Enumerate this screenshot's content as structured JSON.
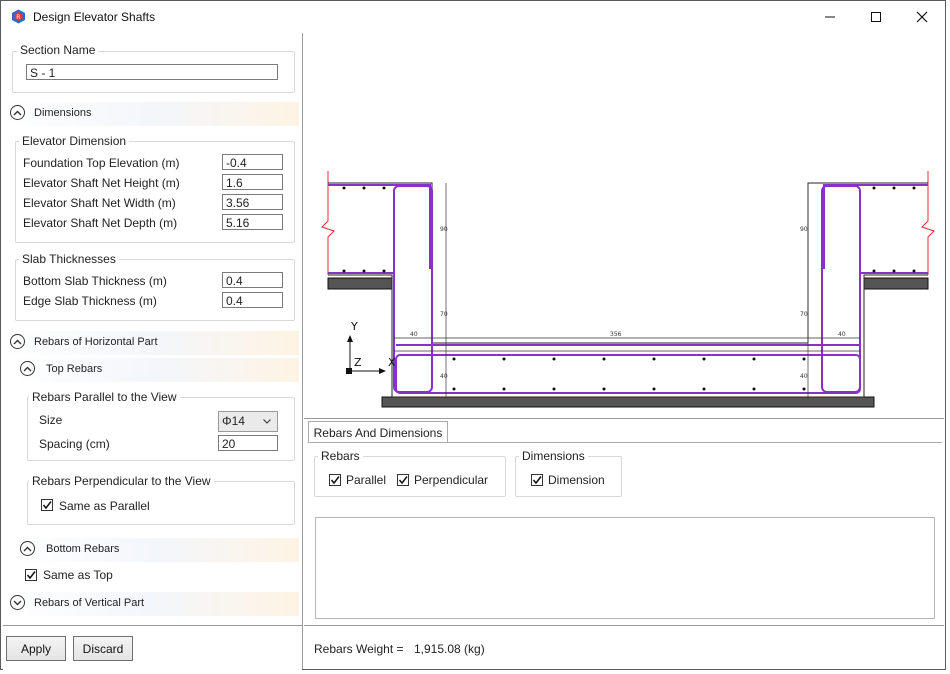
{
  "window": {
    "title": "Design Elevator Shafts",
    "controls": {
      "minimize": "minimize",
      "maximize": "maximize",
      "close": "close"
    }
  },
  "section": {
    "group_title": "Section Name",
    "value": "S - 1"
  },
  "dimensions": {
    "header": "Dimensions",
    "elevator_group": "Elevator Dimension",
    "fields": [
      {
        "label": "Foundation Top Elevation (m)",
        "value": "-0.4"
      },
      {
        "label": "Elevator Shaft Net Height (m)",
        "value": "1.6"
      },
      {
        "label": "Elevator Shaft Net Width (m)",
        "value": "3.56"
      },
      {
        "label": "Elevator Shaft Net Depth (m)",
        "value": "5.16"
      }
    ],
    "slab_group": "Slab Thicknesses",
    "slab_fields": [
      {
        "label": "Bottom Slab Thickness (m)",
        "value": "0.4"
      },
      {
        "label": "Edge Slab Thickness (m)",
        "value": "0.4"
      }
    ]
  },
  "rebars_horizontal": {
    "header": "Rebars of Horizontal Part",
    "top_header": "Top Rebars",
    "parallel_group": "Rebars Parallel to the View",
    "size_label": "Size",
    "size_value": "Φ14",
    "spacing_label": "Spacing (cm)",
    "spacing_value": "20",
    "perp_group": "Rebars Perpendicular to the View",
    "same_as_parallel": "Same as Parallel",
    "bottom_header": "Bottom Rebars",
    "same_as_top": "Same as Top"
  },
  "rebars_vertical": {
    "header": "Rebars of Vertical Part"
  },
  "buttons": {
    "apply": "Apply",
    "discard": "Discard"
  },
  "viewer": {
    "axis_y": "Y",
    "axis_z": "Z",
    "axis_x": "X",
    "dim_labels": {
      "width": "356",
      "wall_left": "40",
      "wall_right": "40",
      "height_left": "90",
      "height_right": "90",
      "slab_left": "40",
      "slab_right": "40",
      "mid_left": "70",
      "mid_right": "70"
    },
    "colors": {
      "rebar": "#8b2fc9",
      "concrete": "#2a2a2a",
      "support": "#555555",
      "cut_line": "#e03030"
    }
  },
  "display_tab": {
    "tab_label": "Rebars And Dimensions",
    "rebars_group": "Rebars",
    "parallel": "Parallel",
    "perpendicular": "Perpendicular",
    "dimensions_group": "Dimensions",
    "dimension": "Dimension"
  },
  "weight": {
    "label": "Rebars Weight =",
    "value": "1,915.08 (kg)"
  }
}
